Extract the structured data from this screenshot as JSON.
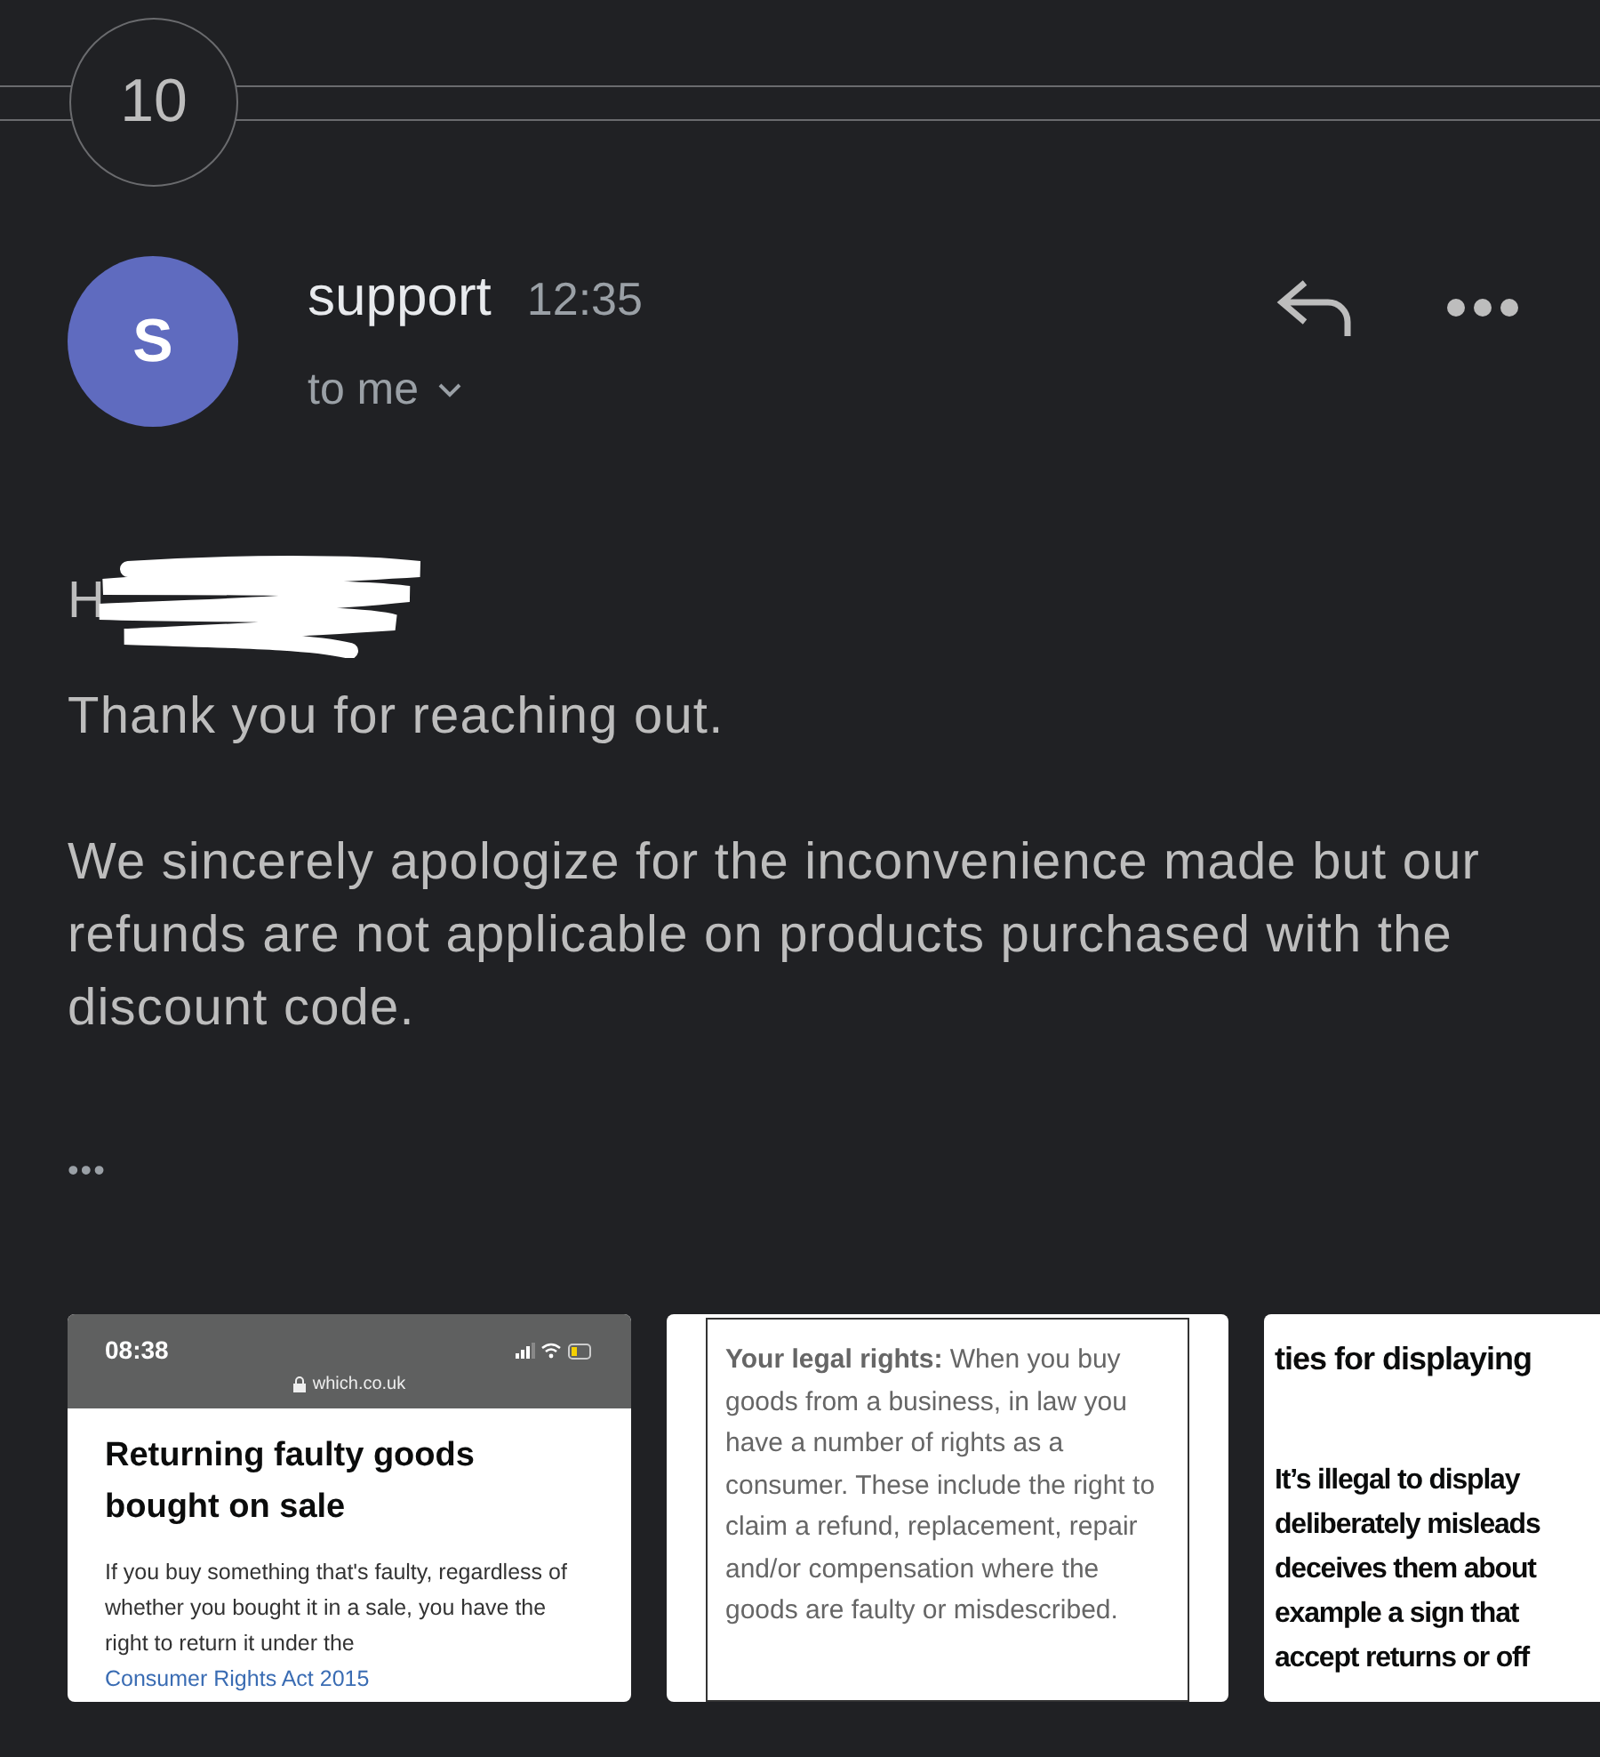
{
  "thread": {
    "count": "10"
  },
  "message": {
    "avatar": "S",
    "sender": "support",
    "time": "12:35",
    "recipient": "to me",
    "greeting": "H",
    "paragraphs": [
      "Thank you for reaching out.",
      "We sincerely apologize for the inconvenience made but our refunds are not applicable on products purchased with the discount code."
    ],
    "more": "•••"
  },
  "attachments": [
    {
      "kind": "phone",
      "clock": "08:38",
      "url": "which.co.uk",
      "title": "Returning faulty goods bought on sale",
      "text": "If you buy something that's faulty, regardless of whether you bought it in a sale, you have the right to return it under",
      "text_end": "the",
      "link": "Consumer Rights Act 2015"
    },
    {
      "kind": "boxed",
      "text": "**Your legal rights:** When you buy goods from a business, in law you have a number of rights as a consumer. These include the right to claim a refund, replacement, repair and/or compensation where the goods are faulty or misdescribed."
    },
    {
      "kind": "bold",
      "heading": "ties for displaying",
      "lines": [
        "It’s illegal to display",
        "deliberately misleads",
        "deceives them about",
        "example a sign that",
        "accept returns or off"
      ]
    }
  ]
}
